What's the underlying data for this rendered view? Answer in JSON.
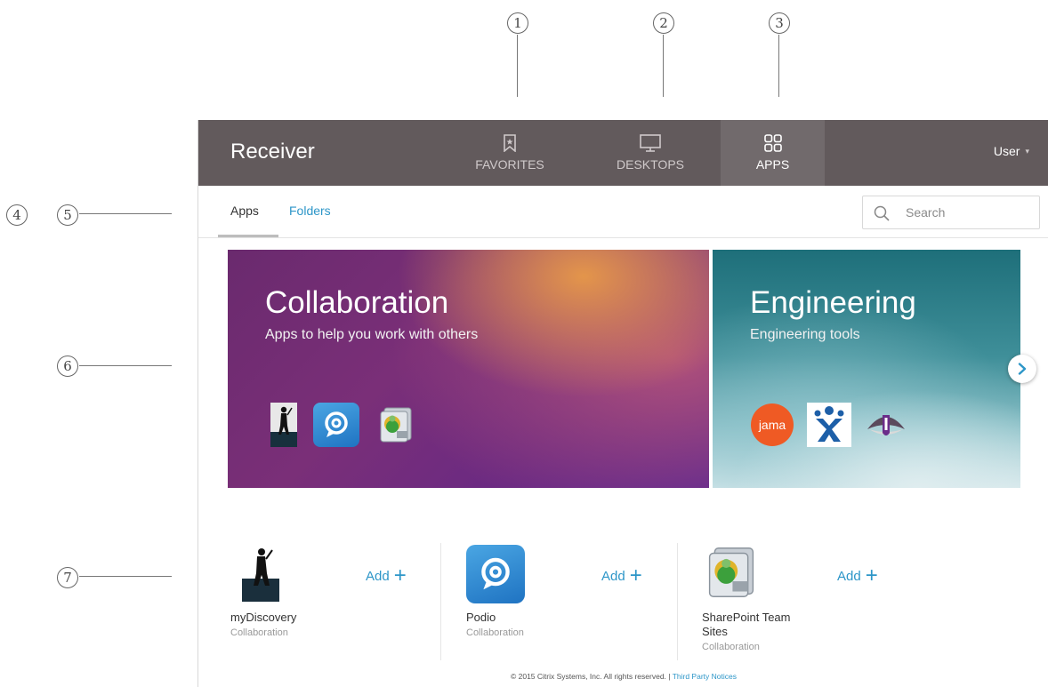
{
  "callouts": [
    "1",
    "2",
    "3",
    "4",
    "5",
    "6",
    "7"
  ],
  "header": {
    "brand": "Receiver",
    "tabs": [
      {
        "label": "FAVORITES",
        "icon": "bookmark-icon",
        "active": false
      },
      {
        "label": "DESKTOPS",
        "icon": "monitor-icon",
        "active": false
      },
      {
        "label": "APPS",
        "icon": "apps-grid-icon",
        "active": true
      }
    ],
    "user": "User",
    "user_caret": "▾"
  },
  "subnav": {
    "tabs": [
      {
        "label": "Apps",
        "active": true
      },
      {
        "label": "Folders",
        "active": false
      }
    ],
    "search_placeholder": "Search"
  },
  "banners": [
    {
      "title": "Collaboration",
      "subtitle": "Apps to help you work with others",
      "icons": [
        "mydiscovery-icon",
        "podio-icon",
        "sharepoint-icon"
      ]
    },
    {
      "title": "Engineering",
      "subtitle": "Engineering tools",
      "icons": [
        "jama-icon",
        "jira-icon",
        "unity-icon"
      ],
      "jama_logo_text": "jama"
    }
  ],
  "apps": [
    {
      "name": "myDiscovery",
      "category": "Collaboration",
      "add_label": "Add",
      "icon": "mydiscovery-icon"
    },
    {
      "name": "Podio",
      "category": "Collaboration",
      "add_label": "Add",
      "icon": "podio-icon"
    },
    {
      "name": "SharePoint Team Sites",
      "name_line1": "SharePoint Team",
      "name_line2": "Sites",
      "category": "Collaboration",
      "add_label": "Add",
      "icon": "sharepoint-icon"
    }
  ],
  "add_symbol": "+",
  "footer": {
    "copyright": "© 2015 Citrix Systems, Inc. All rights reserved. |",
    "link": "Third Party Notices"
  },
  "colors": {
    "header_bg": "#625a5c",
    "header_active_bg": "#716a6c",
    "accent": "#2d96c8",
    "collab_banner": "#6b2a82",
    "eng_banner": "#3f8f99"
  }
}
